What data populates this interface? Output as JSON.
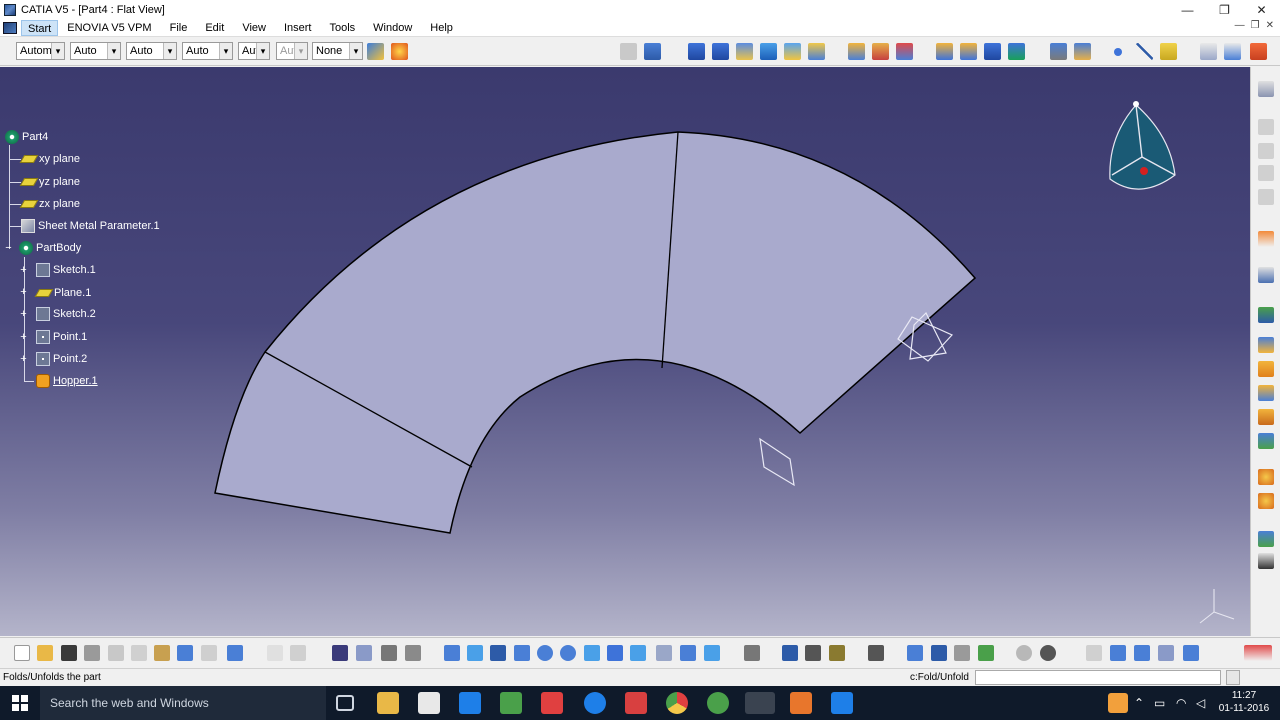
{
  "window": {
    "title": "CATIA V5 - [Part4 : Flat View]",
    "controls": [
      "—",
      "❐",
      "✕"
    ]
  },
  "menubar": {
    "items": [
      "Start",
      "ENOVIA V5 VPM",
      "File",
      "Edit",
      "View",
      "Insert",
      "Tools",
      "Window",
      "Help"
    ],
    "doc_controls": [
      "—",
      "❐",
      "✕"
    ]
  },
  "toolbar": {
    "combos": [
      "Autom",
      "Auto",
      "Auto",
      "Auto",
      "Aut",
      "Aut",
      "None"
    ]
  },
  "tree": {
    "root": "Part4",
    "items": [
      {
        "label": "xy plane",
        "icon": "plane-icon"
      },
      {
        "label": "yz plane",
        "icon": "plane-icon"
      },
      {
        "label": "zx plane",
        "icon": "plane-icon"
      },
      {
        "label": "Sheet Metal Parameter.1",
        "icon": "sheet-metal-parameter-icon"
      },
      {
        "label": "PartBody",
        "icon": "partbody-gear-icon"
      },
      {
        "label": "Sketch.1",
        "icon": "sketch-icon"
      },
      {
        "label": "Plane.1",
        "icon": "plane-icon"
      },
      {
        "label": "Sketch.2",
        "icon": "sketch-icon"
      },
      {
        "label": "Point.1",
        "icon": "point-icon"
      },
      {
        "label": "Point.2",
        "icon": "point-icon"
      },
      {
        "label": "Hopper.1",
        "icon": "hopper-icon"
      }
    ]
  },
  "statusbar": {
    "message": "Folds/Unfolds the part",
    "command_label": "c:Fold/Unfold",
    "command_value": ""
  },
  "taskbar": {
    "search_placeholder": "Search the web and Windows",
    "time": "11:27",
    "date": "01-11-2016"
  },
  "colors": {
    "viewport_top": "#3b3a6e",
    "viewport_bottom": "#b4b4ca",
    "part_fill": "#a9aacd",
    "part_edge": "#000000"
  }
}
